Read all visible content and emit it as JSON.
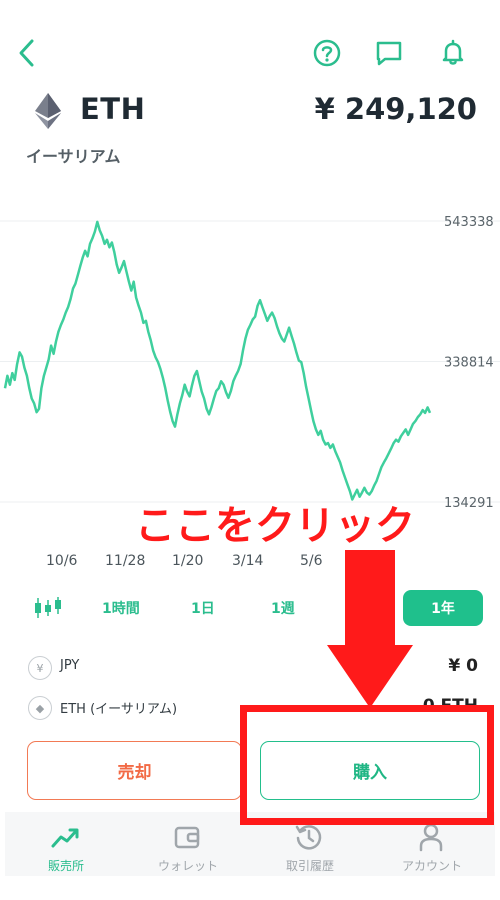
{
  "header": {
    "back_icon": "chevron-left-icon",
    "help_icon": "question-circle-icon",
    "chat_icon": "chat-icon",
    "bell_icon": "bell-icon"
  },
  "asset": {
    "symbol": "ETH",
    "name_ja": "イーサリアム",
    "price": "¥ 249,120"
  },
  "chart_data": {
    "type": "line",
    "x_ticks": [
      "10/6",
      "11/28",
      "1/20",
      "3/14",
      "5/6"
    ],
    "y_ticks": [
      "543338",
      "338814",
      "134291"
    ],
    "ylim": [
      134291,
      543338
    ],
    "color": "#3fcf9d",
    "values": [
      300000,
      318000,
      305000,
      322000,
      312000,
      335000,
      352000,
      346000,
      330000,
      318000,
      300000,
      285000,
      278000,
      265000,
      270000,
      300000,
      318000,
      330000,
      342000,
      362000,
      350000,
      368000,
      382000,
      392000,
      400000,
      410000,
      418000,
      430000,
      445000,
      452000,
      465000,
      478000,
      490000,
      500000,
      492000,
      510000,
      518000,
      528000,
      542000,
      530000,
      522000,
      510000,
      516000,
      505000,
      512000,
      498000,
      480000,
      468000,
      476000,
      485000,
      470000,
      455000,
      442000,
      455000,
      432000,
      420000,
      410000,
      395000,
      398000,
      382000,
      370000,
      355000,
      345000,
      338000,
      328000,
      315000,
      300000,
      282000,
      266000,
      252000,
      244000,
      262000,
      278000,
      290000,
      305000,
      295000,
      288000,
      304000,
      318000,
      325000,
      310000,
      295000,
      285000,
      270000,
      262000,
      272000,
      285000,
      296000,
      300000,
      310000,
      305000,
      294000,
      286000,
      296000,
      310000,
      318000,
      325000,
      335000,
      355000,
      372000,
      385000,
      392000,
      400000,
      404000,
      420000,
      428000,
      418000,
      408000,
      398000,
      405000,
      410000,
      402000,
      390000,
      380000,
      372000,
      368000,
      378000,
      388000,
      376000,
      365000,
      352000,
      340000,
      338000,
      322000,
      302000,
      285000,
      268000,
      252000,
      240000,
      232000,
      238000,
      225000,
      218000,
      220000,
      213000,
      218000,
      208000,
      200000,
      192000,
      180000,
      170000,
      160000,
      150000,
      138000,
      145000,
      152000,
      142000,
      148000,
      155000,
      148000,
      145000,
      150000,
      158000,
      165000,
      175000,
      185000,
      192000,
      198000,
      205000,
      212000,
      220000,
      225000,
      222000,
      230000,
      235000,
      240000,
      232000,
      240000,
      248000,
      252000,
      258000,
      262000,
      268000,
      264000,
      272000,
      264000
    ]
  },
  "periods": {
    "candle_icon": "candlestick-icon",
    "options": [
      "1時間",
      "1日",
      "1週"
    ],
    "active": "1年"
  },
  "balances": [
    {
      "icon_symbol": "¥",
      "label": "JPY",
      "value": "¥ 0"
    },
    {
      "icon_symbol": "◆",
      "label": "ETH (イーサリアム)",
      "value": "0 ETH"
    }
  ],
  "actions": {
    "sell": "売却",
    "buy": "購入"
  },
  "annotation": {
    "text": "ここをクリック",
    "color": "#ff1a1a"
  },
  "tabbar": [
    {
      "label": "販売所",
      "icon": "chart-trend-icon",
      "active": true
    },
    {
      "label": "ウォレット",
      "icon": "wallet-icon",
      "active": false
    },
    {
      "label": "取引履歴",
      "icon": "history-icon",
      "active": false
    },
    {
      "label": "アカウント",
      "icon": "account-icon",
      "active": false
    }
  ]
}
